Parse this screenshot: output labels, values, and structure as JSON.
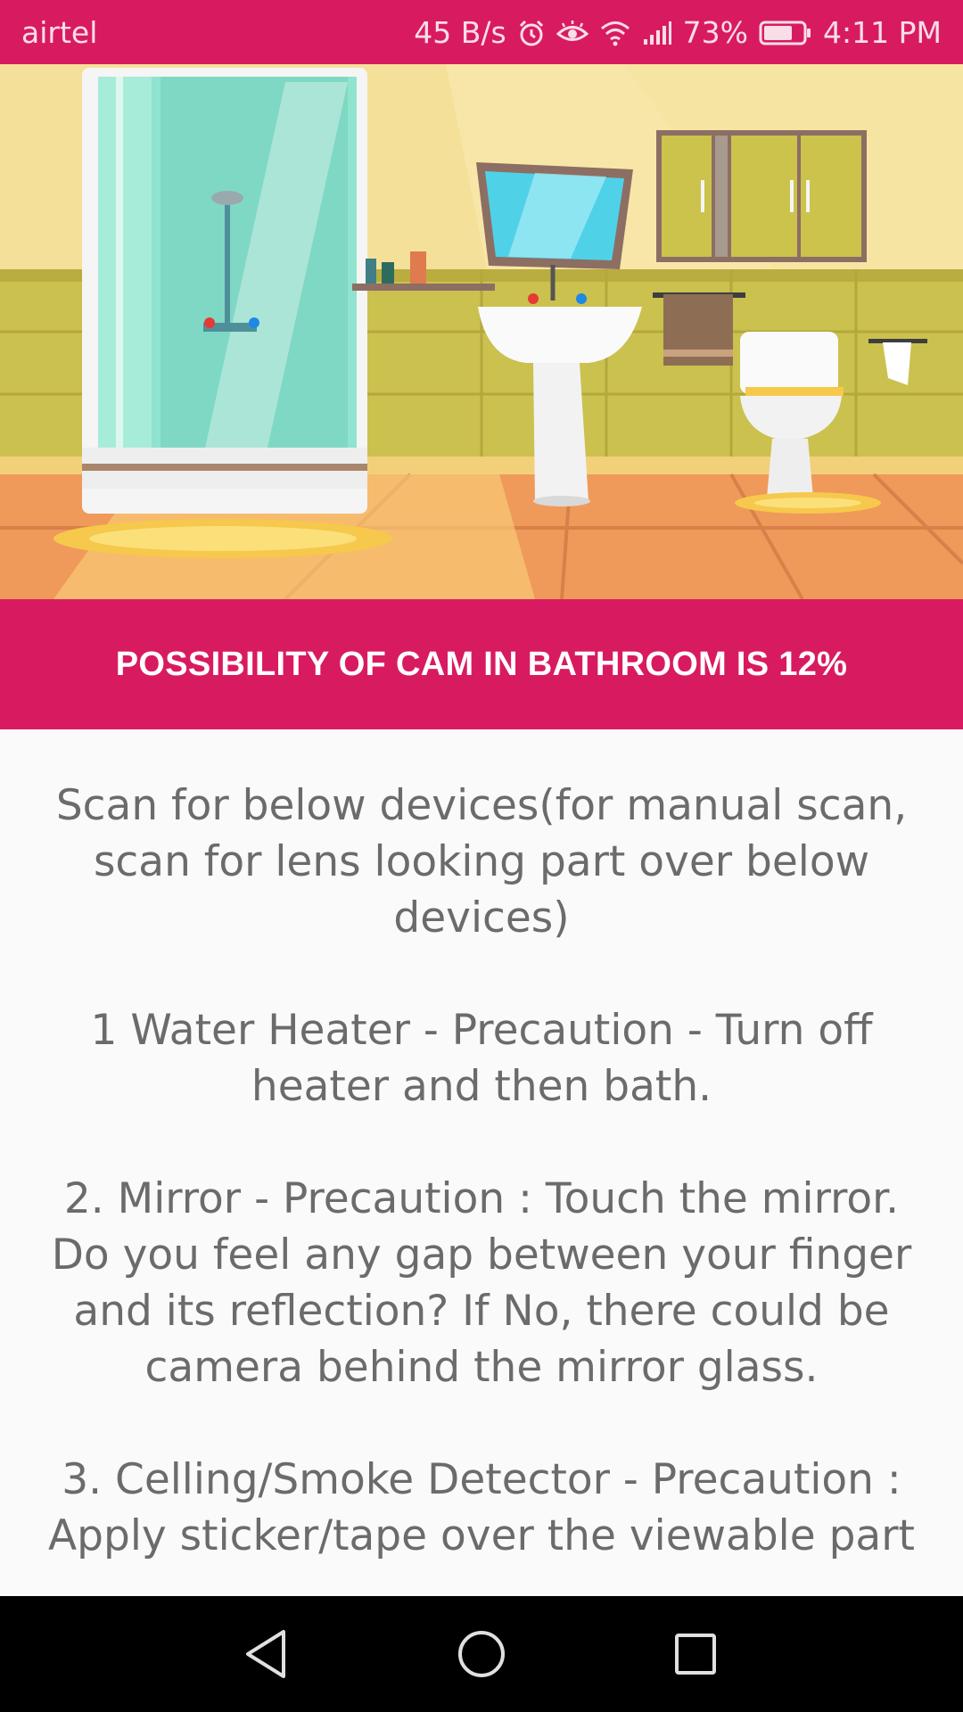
{
  "status_bar": {
    "carrier": "airtel",
    "speed": "45 B/s",
    "battery_percent": "73%",
    "battery_level": 0.73,
    "time": "4:11 PM",
    "icons": [
      "alarm-icon",
      "eye-icon",
      "wifi-icon",
      "signal-icon",
      "battery-icon"
    ]
  },
  "hero": {
    "icon": "bathroom-illustration"
  },
  "banner": {
    "text": "POSSIBILITY OF CAM IN BATHROOM IS 12%"
  },
  "content": {
    "paragraphs": [
      "Scan for below devices(for manual scan, scan for lens looking part over below devices)",
      "1 Water Heater - Precaution - Turn off heater and then bath.",
      "2. Mirror - Precaution : Touch the mirror. Do you feel any gap between your finger and its reflection? If No, there could be camera behind the mirror glass.",
      "3. Celling/Smoke Detector - Precaution : Apply sticker/tape over the viewable part"
    ]
  },
  "nav_bar": {
    "icons": [
      "back-icon",
      "home-icon",
      "recents-icon"
    ]
  },
  "colors": {
    "accent": "#d81b60",
    "text": "#6b6b6b",
    "background": "#fafafa"
  }
}
